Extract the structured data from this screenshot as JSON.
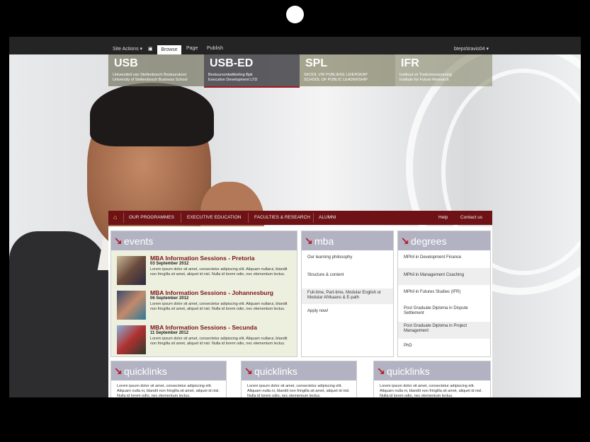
{
  "toolbar": {
    "site_actions": "Site Actions ▾",
    "browse": "Browse",
    "page": "Page",
    "publish": "Publish",
    "user": "bteps\\travis04 ▾"
  },
  "sites": [
    {
      "code": "USB",
      "desc1": "Universiteit van Stellenbosch Bestuurskool",
      "desc2": "University of Stellenbosch Business School"
    },
    {
      "code": "USB-ED",
      "desc1": "Bestuursontwikkeling Bpk",
      "desc2": "Executive Development LTD"
    },
    {
      "code": "SPL",
      "desc1": "SKOOL VIR PUBLIEKE LEIERSKAP",
      "desc2": "SCHOOL OF PUBLIC LEADERSHIP"
    },
    {
      "code": "IFR",
      "desc1": "Instituut vir Toekomsnavorsing",
      "desc2": "Institute for Future Research"
    }
  ],
  "nav": {
    "home": "⌂",
    "our_programmes": "OUR PROGRAMMES",
    "executive_education": "EXECUTIVE EDUCATION",
    "faculties_research": "FACULTIES & RESEARCH",
    "alumni": "ALUMNI",
    "help": "Help",
    "contact_us": "Contact us"
  },
  "panels": {
    "events_title": "events",
    "mba_title": "mba",
    "degrees_title": "degrees",
    "quicklinks_title": "quicklinks"
  },
  "events": [
    {
      "title": "MBA Information Sessions - Pretoria",
      "date": "03 September 2012",
      "text": "Lorem ipsum dolor sit amet, consectetur adipiscing elit. Aliquam nullarui, blandit non fringilla sit amet, aliquet id nisl. Nulla id lorem odio, nec elementum lectus."
    },
    {
      "title": "MBA Information Sessions - Johannesburg",
      "date": "06 September 2012",
      "text": "Lorem ipsum dolor sit amet, consectetur adipiscing elit. Aliquam nullarui, blandit non fringilla sit amet, aliquet id nisl. Nulla id lorem odio, nec elementum lectus."
    },
    {
      "title": "MBA Information Sessions - Secunda",
      "date": "11 September 2012",
      "text": "Lorem ipsum dolor sit amet, consectetur adipiscing elit. Aliquam nullarui, blandit non fringilla sit amet, aliquet id nisl. Nulla id lorem odio, nec elementum lectus."
    }
  ],
  "mba_links": [
    "Our learning philosophy",
    "Structure & content",
    "Full-time, Part-time, Modular English or Modular Afrikaans & E-path",
    "Apply now!"
  ],
  "degree_links": [
    "MPhil in Development Finance",
    "MPhil in Management Coaching",
    "MPhil in Futures Studies (IFR)",
    "Post Graduate Diploma in Dispute Settlement",
    "Post Graduate Diploma in Project Management",
    "PhD"
  ],
  "quicklinks_text": "Lorem ipsum dolor sit amet, consectetur adipiscing elit. Aliquam nulla ni, blandit non fringilla sit amet, aliquet id nisl. Nulla id lorem odio, nec elementum lectus."
}
